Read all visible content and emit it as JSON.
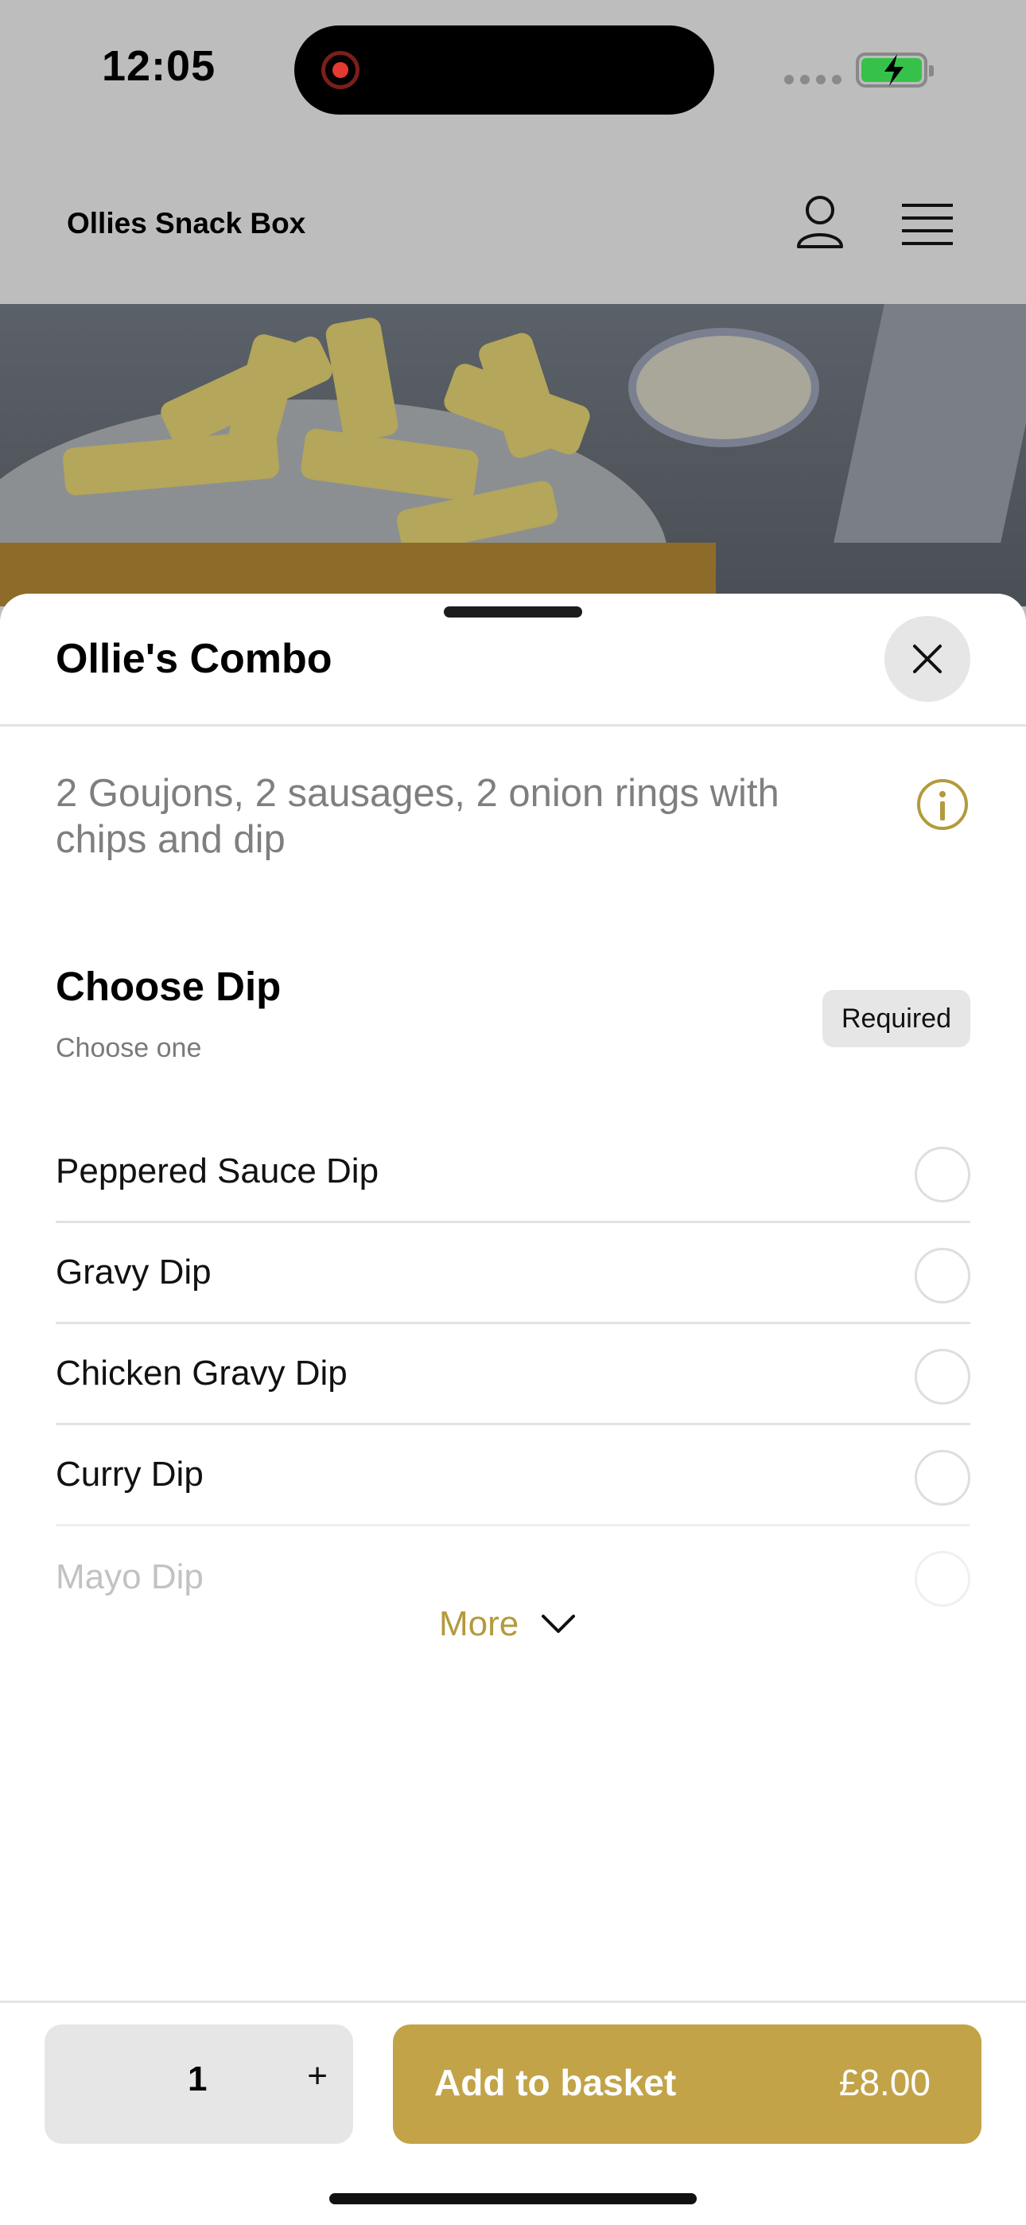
{
  "status_bar": {
    "time": "12:05"
  },
  "header": {
    "brand": "Ollies Snack Box",
    "icons": [
      "user-icon",
      "menu-icon"
    ]
  },
  "sheet": {
    "title": "Ollie's Combo",
    "description": "2 Goujons, 2 sausages, 2 onion rings with chips and dip",
    "section": {
      "title": "Choose Dip",
      "subtitle": "Choose one",
      "badge": "Required",
      "options": [
        {
          "label": "Peppered Sauce Dip"
        },
        {
          "label": "Gravy Dip"
        },
        {
          "label": "Chicken Gravy Dip"
        },
        {
          "label": "Curry Dip"
        },
        {
          "label": "Mayo Dip"
        }
      ]
    },
    "more_label": "More"
  },
  "footer": {
    "quantity": "1",
    "plus_label": "+",
    "add_label": "Add to basket",
    "price": "£8.00"
  },
  "colors": {
    "accent": "#c2a348",
    "accent_text": "#b39a3c"
  }
}
